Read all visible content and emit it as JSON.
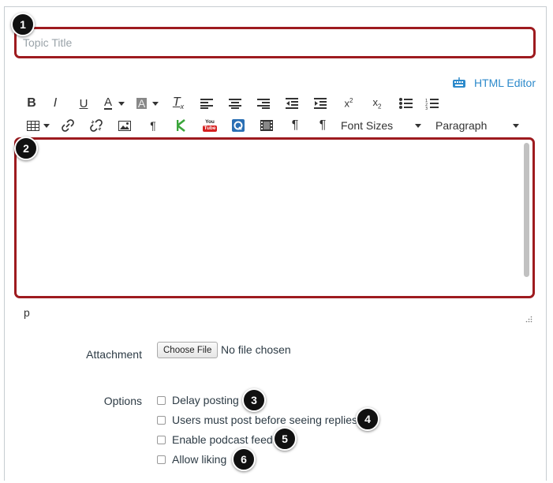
{
  "topic_title": {
    "placeholder": "Topic Title"
  },
  "html_editor": {
    "label": "HTML Editor",
    "icon": "keyboard-icon"
  },
  "toolbar": {
    "row1": [
      {
        "name": "bold-button",
        "glyph": "B"
      },
      {
        "name": "italic-button",
        "glyph": "I"
      },
      {
        "name": "underline-button",
        "glyph": "U"
      },
      {
        "name": "text-color-button",
        "glyph": "A"
      },
      {
        "name": "background-color-button",
        "glyph": "A"
      },
      {
        "name": "clear-formatting-button",
        "glyph": "Tx"
      },
      {
        "name": "align-left-button",
        "glyph": "align-left"
      },
      {
        "name": "align-center-button",
        "glyph": "align-center"
      },
      {
        "name": "align-right-button",
        "glyph": "align-right"
      },
      {
        "name": "outdent-button",
        "glyph": "outdent"
      },
      {
        "name": "indent-button",
        "glyph": "indent"
      },
      {
        "name": "superscript-button",
        "glyph": "x2-sup"
      },
      {
        "name": "subscript-button",
        "glyph": "x2-sub"
      },
      {
        "name": "bullet-list-button",
        "glyph": "bullets"
      },
      {
        "name": "numbered-list-button",
        "glyph": "numbers"
      }
    ],
    "font_sizes_label": "Font Sizes",
    "paragraph_label": "Paragraph"
  },
  "youtube_icon_text": {
    "top": "You",
    "bottom": "Tube"
  },
  "status_path": "p",
  "attachment": {
    "label": "Attachment",
    "button": "Choose File",
    "status": "No file chosen"
  },
  "options": {
    "label": "Options",
    "items": [
      {
        "label": "Delay posting",
        "checked": false,
        "callout": "3"
      },
      {
        "label": "Users must post before seeing replies",
        "checked": false,
        "callout": "4"
      },
      {
        "label": "Enable podcast feed",
        "checked": false,
        "callout": "5"
      },
      {
        "label": "Allow liking",
        "checked": false,
        "callout": "6"
      }
    ]
  },
  "callouts": {
    "title": "1",
    "editor": "2"
  },
  "colors": {
    "highlight_border": "#9e1b1f",
    "link_blue": "#2d8acb",
    "callout_bg": "#111111"
  }
}
